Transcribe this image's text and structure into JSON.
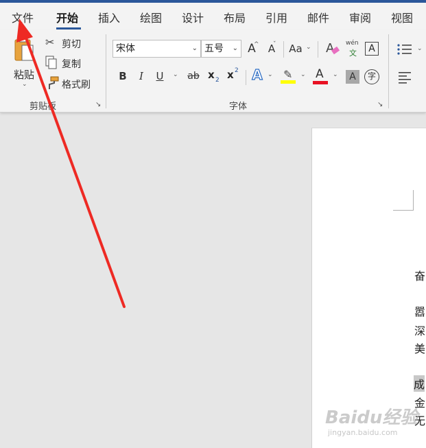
{
  "menu": {
    "tabs": [
      "文件",
      "开始",
      "插入",
      "绘图",
      "设计",
      "布局",
      "引用",
      "邮件",
      "审阅",
      "视图"
    ]
  },
  "clipboard": {
    "paste_label": "粘贴",
    "cut_label": "剪切",
    "copy_label": "复制",
    "format_painter_label": "格式刷",
    "group_label": "剪贴板"
  },
  "font": {
    "font_name": "宋体",
    "font_size": "五号",
    "group_label": "字体",
    "grow_font": "A",
    "shrink_font": "A",
    "change_case": "Aa",
    "phonetic_top": "wén",
    "phonetic_bottom": "文",
    "char_border": "A",
    "bold": "B",
    "italic": "I",
    "underline": "U",
    "strikethrough": "ab",
    "subscript": "x",
    "subscript_mark": "2",
    "superscript": "x",
    "superscript_mark": "2",
    "text_effects": "A",
    "font_color": "A",
    "char_shading": "A",
    "enclose_char": "字"
  },
  "document": {
    "lines": [
      "奋",
      "嚣",
      "深",
      "美",
      "成",
      "金",
      "无"
    ]
  },
  "watermark": {
    "brand": "Baidu经验",
    "url": "jingyan.baidu.com"
  },
  "colors": {
    "accent": "#2b579a",
    "highlight_yellow": "#ffff00",
    "font_red": "#e81123",
    "arrow_red": "#ee2a24"
  }
}
